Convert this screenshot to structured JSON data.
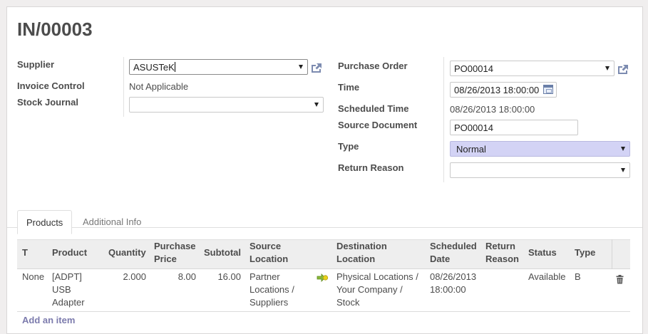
{
  "title": "IN/00003",
  "left_fields": {
    "supplier_label": "Supplier",
    "supplier_value": "ASUSTeK",
    "invoice_control_label": "Invoice Control",
    "invoice_control_value": "Not Applicable",
    "stock_journal_label": "Stock Journal",
    "stock_journal_value": ""
  },
  "right_fields": {
    "purchase_order_label": "Purchase Order",
    "purchase_order_value": "PO00014",
    "time_label": "Time",
    "time_value": "08/26/2013 18:00:00",
    "scheduled_time_label": "Scheduled Time",
    "scheduled_time_value": "08/26/2013 18:00:00",
    "source_document_label": "Source Document",
    "source_document_value": "PO00014",
    "type_label": "Type",
    "type_value": "Normal",
    "return_reason_label": "Return Reason",
    "return_reason_value": ""
  },
  "tabs": [
    {
      "label": "Products"
    },
    {
      "label": "Additional Info"
    }
  ],
  "table": {
    "headers": {
      "t": "T",
      "product": "Product",
      "quantity": "Quantity",
      "purchase_price_1": "Purchase",
      "purchase_price_2": "Price",
      "subtotal": "Subtotal",
      "source_location_1": "Source",
      "source_location_2": "Location",
      "destination_location_1": "Destination",
      "destination_location_2": "Location",
      "scheduled_date_1": "Scheduled",
      "scheduled_date_2": "Date",
      "return_reason_1": "Return",
      "return_reason_2": "Reason",
      "status": "Status",
      "type": "Type"
    },
    "rows": [
      {
        "t": "None",
        "product_1": "[ADPT]",
        "product_2": "USB",
        "product_3": "Adapter",
        "quantity": "2.000",
        "purchase_price": "8.00",
        "subtotal": "16.00",
        "source_location_1": "Partner",
        "source_location_2": "Locations /",
        "source_location_3": "Suppliers",
        "destination_location_1": "Physical Locations /",
        "destination_location_2": "Your Company /",
        "destination_location_3": "Stock",
        "scheduled_date_1": "08/26/2013",
        "scheduled_date_2": "18:00:00",
        "return_reason": "",
        "status": "Available",
        "type": "B"
      }
    ],
    "add_item": "Add an item"
  },
  "colors": {
    "accent": "#7c7bad",
    "type_field_bg": "#d3d3f5",
    "header_bg": "#eeeeee",
    "background": "#f0eeee"
  },
  "icons": {
    "external_link": "external-link-icon",
    "dropdown": "chevron-down-icon",
    "calendar": "calendar-icon",
    "arrow": "move-arrow-icon",
    "delete": "trash-icon"
  }
}
